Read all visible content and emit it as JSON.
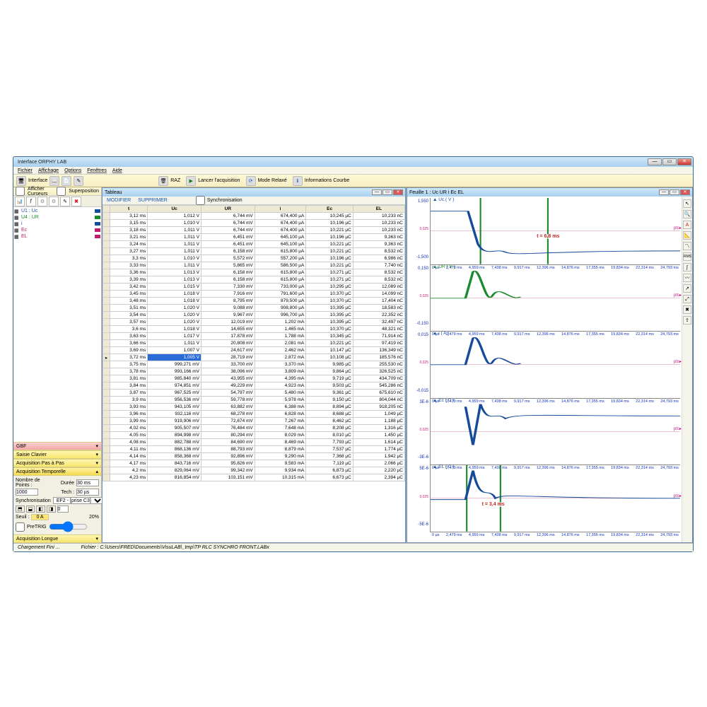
{
  "window": {
    "title": "Interface ORPHY LAB"
  },
  "menu": {
    "items": [
      "Fichier",
      "Affichage",
      "Options",
      "Fenêtres",
      "Aide"
    ]
  },
  "toolbar": {
    "interface_label": "Interface",
    "raz": "RAZ",
    "lancer": "Lancer l'acquisition",
    "mode": "Mode Relaxé",
    "info": "Informations Courbe"
  },
  "sidebar": {
    "curs_label": "Afficher Curseurs",
    "superposition": "Superposition",
    "vars": [
      {
        "name": "U1 : Uc",
        "color": "#164a9a"
      },
      {
        "name": "U4 : UR",
        "color": "#1b8a2b"
      },
      {
        "name": "i",
        "color": "#164a9a"
      },
      {
        "name": "Ec",
        "color": "#c01c6a"
      },
      {
        "name": "EL",
        "color": "#c01c6a"
      }
    ],
    "accordion": {
      "gbf": "GBF",
      "saisie": "Saisie Clavier",
      "pas": "Acquisition Pas à Pas",
      "temporelle": "Acquisition Temporelle",
      "np_label": "Nombre de\nPoints :",
      "np_value": "1000",
      "duree_label": "Durée",
      "duree_value": "30 ms",
      "tech_label": "Tech :",
      "tech_value": "30 µs",
      "sync_label": "Synchronisation",
      "sync_value": "EF2 - [prise C3]",
      "seuil_label": "Seuil :",
      "seuil_value": "0 A",
      "seuil_pct": "20%",
      "pretrig": "PreTRIG",
      "longue": "Acquisition Longue"
    }
  },
  "tableau": {
    "title": "Tableau",
    "modifier": "MODIFIER",
    "supprimer": "SUPPRIMER",
    "sync": "Synchronisation",
    "headers": [
      "",
      "t",
      "Uc",
      "UR",
      "i",
      "Ec",
      "EL"
    ],
    "selected_row_index": 20,
    "rows": [
      [
        "3,12 ms",
        "1,012 V",
        "6,744 mV",
        "674,400 µA",
        "10,245 µC",
        "10,233 nC"
      ],
      [
        "3,15 ms",
        "1,010 V",
        "6,744 mV",
        "674,400 µA",
        "10,196 µC",
        "10,233 nC"
      ],
      [
        "3,18 ms",
        "1,011 V",
        "6,744 mV",
        "674,400 µA",
        "10,221 µC",
        "10,233 nC"
      ],
      [
        "3,21 ms",
        "1,011 V",
        "6,451 mV",
        "645,100 µA",
        "10,196 µC",
        "9,363 nC"
      ],
      [
        "3,24 ms",
        "1,011 V",
        "6,451 mV",
        "645,100 µA",
        "10,221 µC",
        "9,363 nC"
      ],
      [
        "3,27 ms",
        "1,011 V",
        "6,158 mV",
        "615,800 µA",
        "10,221 µC",
        "8,532 nC"
      ],
      [
        "3,3 ms",
        "1,010 V",
        "5,572 mV",
        "557,200 µA",
        "10,196 µC",
        "6,986 nC"
      ],
      [
        "3,33 ms",
        "1,011 V",
        "5,865 mV",
        "586,500 µA",
        "10,221 µC",
        "7,740 nC"
      ],
      [
        "3,36 ms",
        "1,013 V",
        "6,158 mV",
        "615,800 µA",
        "10,271 µC",
        "8,532 nC"
      ],
      [
        "3,39 ms",
        "1,013 V",
        "6,158 mV",
        "615,800 µA",
        "10,271 µC",
        "8,532 nC"
      ],
      [
        "3,42 ms",
        "1,015 V",
        "7,330 mV",
        "733,000 µA",
        "10,295 µC",
        "12,089 nC"
      ],
      [
        "3,45 ms",
        "1,018 V",
        "7,916 mV",
        "791,600 µA",
        "10,370 µC",
        "14,099 nC"
      ],
      [
        "3,48 ms",
        "1,018 V",
        "8,795 mV",
        "879,500 µA",
        "10,370 µC",
        "17,404 nC"
      ],
      [
        "3,51 ms",
        "1,020 V",
        "9,088 mV",
        "908,800 µA",
        "10,395 µC",
        "18,583 nC"
      ],
      [
        "3,54 ms",
        "1,020 V",
        "9,967 mV",
        "996,700 µA",
        "10,395 µC",
        "22,352 nC"
      ],
      [
        "3,57 ms",
        "1,020 V",
        "12,019 mV",
        "1,202 mA",
        "10,395 µC",
        "32,497 nC"
      ],
      [
        "3,6 ms",
        "1,018 V",
        "14,655 mV",
        "1,465 mA",
        "10,370 µC",
        "48,321 nC"
      ],
      [
        "3,63 ms",
        "1,017 V",
        "17,878 mV",
        "1,788 mA",
        "10,345 µC",
        "71,914 nC"
      ],
      [
        "3,66 ms",
        "1,011 V",
        "20,808 mV",
        "2,081 mA",
        "10,221 µC",
        "97,419 nC"
      ],
      [
        "3,69 ms",
        "1,007 V",
        "24,617 mV",
        "2,462 mA",
        "10,147 µC",
        "136,349 nC"
      ],
      [
        "3,72 ms",
        "1,005 V",
        "28,719 mV",
        "2,872 mA",
        "10,108 µC",
        "185,576 nC"
      ],
      [
        "3,75 ms",
        "999,271 mV",
        "33,700 mV",
        "3,370 mA",
        "9,985 µC",
        "255,530 nC"
      ],
      [
        "3,78 ms",
        "993,166 mV",
        "38,096 mV",
        "3,809 mA",
        "9,864 µC",
        "326,525 nC"
      ],
      [
        "3,81 ms",
        "985,840 mV",
        "43,955 mV",
        "4,395 mA",
        "9,719 µC",
        "434,709 nC"
      ],
      [
        "3,84 ms",
        "974,851 mV",
        "49,229 mV",
        "4,923 mA",
        "9,503 µC",
        "545,286 nC"
      ],
      [
        "3,87 ms",
        "967,525 mV",
        "54,797 mV",
        "5,480 mA",
        "9,361 µC",
        "675,610 nC"
      ],
      [
        "3,9 ms",
        "956,536 mV",
        "59,778 mV",
        "5,978 mA",
        "9,150 µC",
        "804,044 nC"
      ],
      [
        "3,93 ms",
        "943,105 mV",
        "63,882 mV",
        "6,388 mA",
        "8,894 µC",
        "918,205 nC"
      ],
      [
        "3,96 ms",
        "932,116 mV",
        "68,278 mV",
        "6,828 mA",
        "8,688 µC",
        "1,049 µC"
      ],
      [
        "3,99 ms",
        "919,906 mV",
        "72,674 mV",
        "7,267 mA",
        "8,462 µC",
        "1,188 µC"
      ],
      [
        "4,02 ms",
        "905,507 mV",
        "76,484 mV",
        "7,648 mA",
        "8,208 µC",
        "1,316 µC"
      ],
      [
        "4,05 ms",
        "894,998 mV",
        "80,294 mV",
        "8,029 mA",
        "8,010 µC",
        "1,450 µC"
      ],
      [
        "4,08 ms",
        "882,788 mV",
        "84,690 mV",
        "8,469 mA",
        "7,793 µC",
        "1,614 µC"
      ],
      [
        "4,11 ms",
        "868,136 mV",
        "88,793 mV",
        "8,879 mA",
        "7,537 µC",
        "1,774 µC"
      ],
      [
        "4,14 ms",
        "858,368 mV",
        "92,896 mV",
        "9,290 mA",
        "7,368 µC",
        "1,942 µC"
      ],
      [
        "4,17 ms",
        "843,716 mV",
        "95,826 mV",
        "9,583 mA",
        "7,119 µC",
        "2,066 µC"
      ],
      [
        "4,2 ms",
        "829,064 mV",
        "99,342 mV",
        "9,934 mA",
        "6,873 µC",
        "2,220 µC"
      ],
      [
        "4,23 ms",
        "816,854 mV",
        "103,151 mV",
        "10,315 mA",
        "6,673 µC",
        "2,394 µC"
      ]
    ]
  },
  "feuille": {
    "title": "Feuille 1 :  Uc UR i Ec EL",
    "charts": [
      {
        "label": "Uc ( V )",
        "color": "#164a9a",
        "ylo": "-1,500",
        "yhi": "1,550",
        "annotation": "t = 6,8 ms",
        "ann_pos": 42
      },
      {
        "label": "UR ( V )",
        "color": "#1b8a2b",
        "ylo": "-0,150",
        "yhi": "0,150"
      },
      {
        "label": "i ( A )",
        "color": "#164a9a",
        "ylo": "-0,015",
        "yhi": "0,015"
      },
      {
        "label": "Ec ( C )",
        "color": "#164a9a",
        "ylo": "-3E-6",
        "yhi": "3E-6"
      },
      {
        "label": "EL ( C )",
        "color": "#164a9a",
        "ylo": "-5E-6",
        "yhi": "5E-6",
        "annotation": "t = 3,4 ms",
        "ann_pos": 20
      }
    ],
    "xticks": [
      "0 µs",
      "2,479 ms",
      "4,959 ms",
      "7,438 ms",
      "9,917 ms",
      "12,396 ms",
      "14,876 ms",
      "17,355 ms",
      "19,834 ms",
      "22,314 ms",
      "24,793 ms"
    ],
    "side_label": "pts"
  },
  "status": {
    "left": "Chargement Fini ...",
    "path": "Fichier : C:\\Users\\FRED\\Documents\\VisuLAB\\_tmp\\TP RLC SYNCHRO FRONT.LABx"
  },
  "chart_data": {
    "type": "line",
    "x_range_ms": [
      0,
      24.793
    ],
    "xticks_ms": [
      0,
      2.479,
      4.959,
      7.438,
      9.917,
      12.396,
      14.876,
      17.355,
      19.834,
      22.314,
      24.793
    ],
    "series": [
      {
        "name": "Uc",
        "unit": "V",
        "ylim": [
          -1.5,
          1.55
        ],
        "points": [
          [
            0,
            1.01
          ],
          [
            3.7,
            1.0
          ],
          [
            5.2,
            -1.02
          ],
          [
            7.0,
            -0.95
          ],
          [
            8.4,
            -1.05
          ],
          [
            10.4,
            -1.0
          ],
          [
            24.79,
            -1.0
          ]
        ],
        "markers_ms": [
          4.959,
          11.8
        ],
        "annotation": "t = 6,8 ms"
      },
      {
        "name": "UR",
        "unit": "V",
        "ylim": [
          -0.15,
          0.15
        ],
        "points": [
          [
            0,
            0.006
          ],
          [
            3.6,
            0.007
          ],
          [
            4.3,
            0.103
          ],
          [
            5.2,
            -0.03
          ],
          [
            6.2,
            0.02
          ],
          [
            7.3,
            -0.006
          ],
          [
            8.5,
            0.002
          ],
          [
            24.79,
            0.001
          ]
        ]
      },
      {
        "name": "i",
        "unit": "A",
        "ylim": [
          -0.015,
          0.015
        ],
        "points": [
          [
            0,
            0.0007
          ],
          [
            3.6,
            0.0007
          ],
          [
            4.3,
            0.0103
          ],
          [
            5.2,
            -0.003
          ],
          [
            6.2,
            0.002
          ],
          [
            7.3,
            -0.0006
          ],
          [
            8.5,
            0.0002
          ],
          [
            24.79,
            0.0001
          ]
        ]
      },
      {
        "name": "Ec",
        "unit": "C",
        "ylim": [
          -3e-06,
          3e-06
        ],
        "points": [
          [
            0,
            1.02e-05
          ],
          [
            0.05,
            1.02e-05
          ]
        ],
        "note": "visible segment shows decaying-oscillation within ~3-9ms",
        "visible_points": [
          [
            3.6,
            2.4e-06
          ],
          [
            4.3,
            5e-07
          ],
          [
            5.0,
            2.9e-06
          ],
          [
            5.8,
            1.6e-06
          ],
          [
            6.8,
            2.4e-06
          ],
          [
            8.2,
            2.1e-06
          ],
          [
            24.79,
            2.05e-06
          ]
        ]
      },
      {
        "name": "EL",
        "unit": "C",
        "ylim": [
          -5e-06,
          5e-06
        ],
        "points": [
          [
            0,
            1e-08
          ],
          [
            3.6,
            1e-08
          ],
          [
            4.3,
            2.4e-06
          ],
          [
            5.2,
            2e-07
          ],
          [
            6.2,
            6e-07
          ],
          [
            7.3,
            5e-08
          ],
          [
            24.79,
            2e-08
          ]
        ],
        "markers_ms": [
          3.6,
          7.0
        ],
        "annotation": "t = 3,4 ms"
      }
    ]
  }
}
